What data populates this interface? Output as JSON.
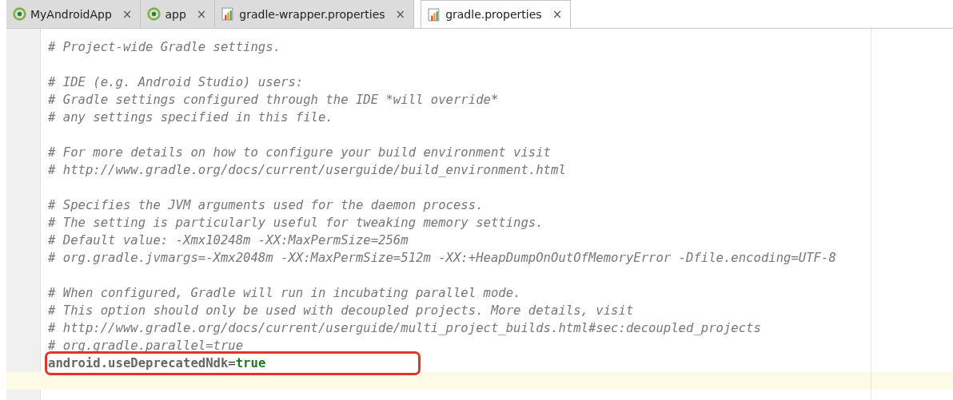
{
  "tabs": [
    {
      "label": "MyAndroidApp",
      "kind": "module",
      "selected": false,
      "close": "×"
    },
    {
      "label": "app",
      "kind": "module",
      "selected": false,
      "close": "×"
    },
    {
      "label": "gradle-wrapper.properties",
      "kind": "properties",
      "selected": false,
      "close": "×"
    },
    {
      "label": "gradle.properties",
      "kind": "properties",
      "selected": true,
      "close": "×"
    }
  ],
  "editor": {
    "lines": [
      {
        "kind": "comment",
        "text": "# Project-wide Gradle settings."
      },
      {
        "kind": "blank"
      },
      {
        "kind": "comment",
        "text": "# IDE (e.g. Android Studio) users:"
      },
      {
        "kind": "comment",
        "text": "# Gradle settings configured through the IDE *will override*"
      },
      {
        "kind": "comment",
        "text": "# any settings specified in this file."
      },
      {
        "kind": "blank"
      },
      {
        "kind": "comment",
        "text": "# For more details on how to configure your build environment visit"
      },
      {
        "kind": "comment",
        "text": "# http://www.gradle.org/docs/current/userguide/build_environment.html"
      },
      {
        "kind": "blank"
      },
      {
        "kind": "comment",
        "text": "# Specifies the JVM arguments used for the daemon process."
      },
      {
        "kind": "comment",
        "text": "# The setting is particularly useful for tweaking memory settings."
      },
      {
        "kind": "comment",
        "text": "# Default value: -Xmx10248m -XX:MaxPermSize=256m"
      },
      {
        "kind": "comment",
        "text": "# org.gradle.jvmargs=-Xmx2048m -XX:MaxPermSize=512m -XX:+HeapDumpOnOutOfMemoryError -Dfile.encoding=UTF-8"
      },
      {
        "kind": "blank"
      },
      {
        "kind": "comment",
        "text": "# When configured, Gradle will run in incubating parallel mode."
      },
      {
        "kind": "comment",
        "text": "# This option should only be used with decoupled projects. More details, visit"
      },
      {
        "kind": "comment",
        "text": "# http://www.gradle.org/docs/current/userguide/multi_project_builds.html#sec:decoupled_projects"
      },
      {
        "kind": "comment",
        "text": "# org.gradle.parallel=true"
      },
      {
        "kind": "property",
        "key": "android.useDeprecatedNdk",
        "separator": "=",
        "value": "true",
        "highlighted": true
      },
      {
        "kind": "blank",
        "current": true
      }
    ]
  }
}
